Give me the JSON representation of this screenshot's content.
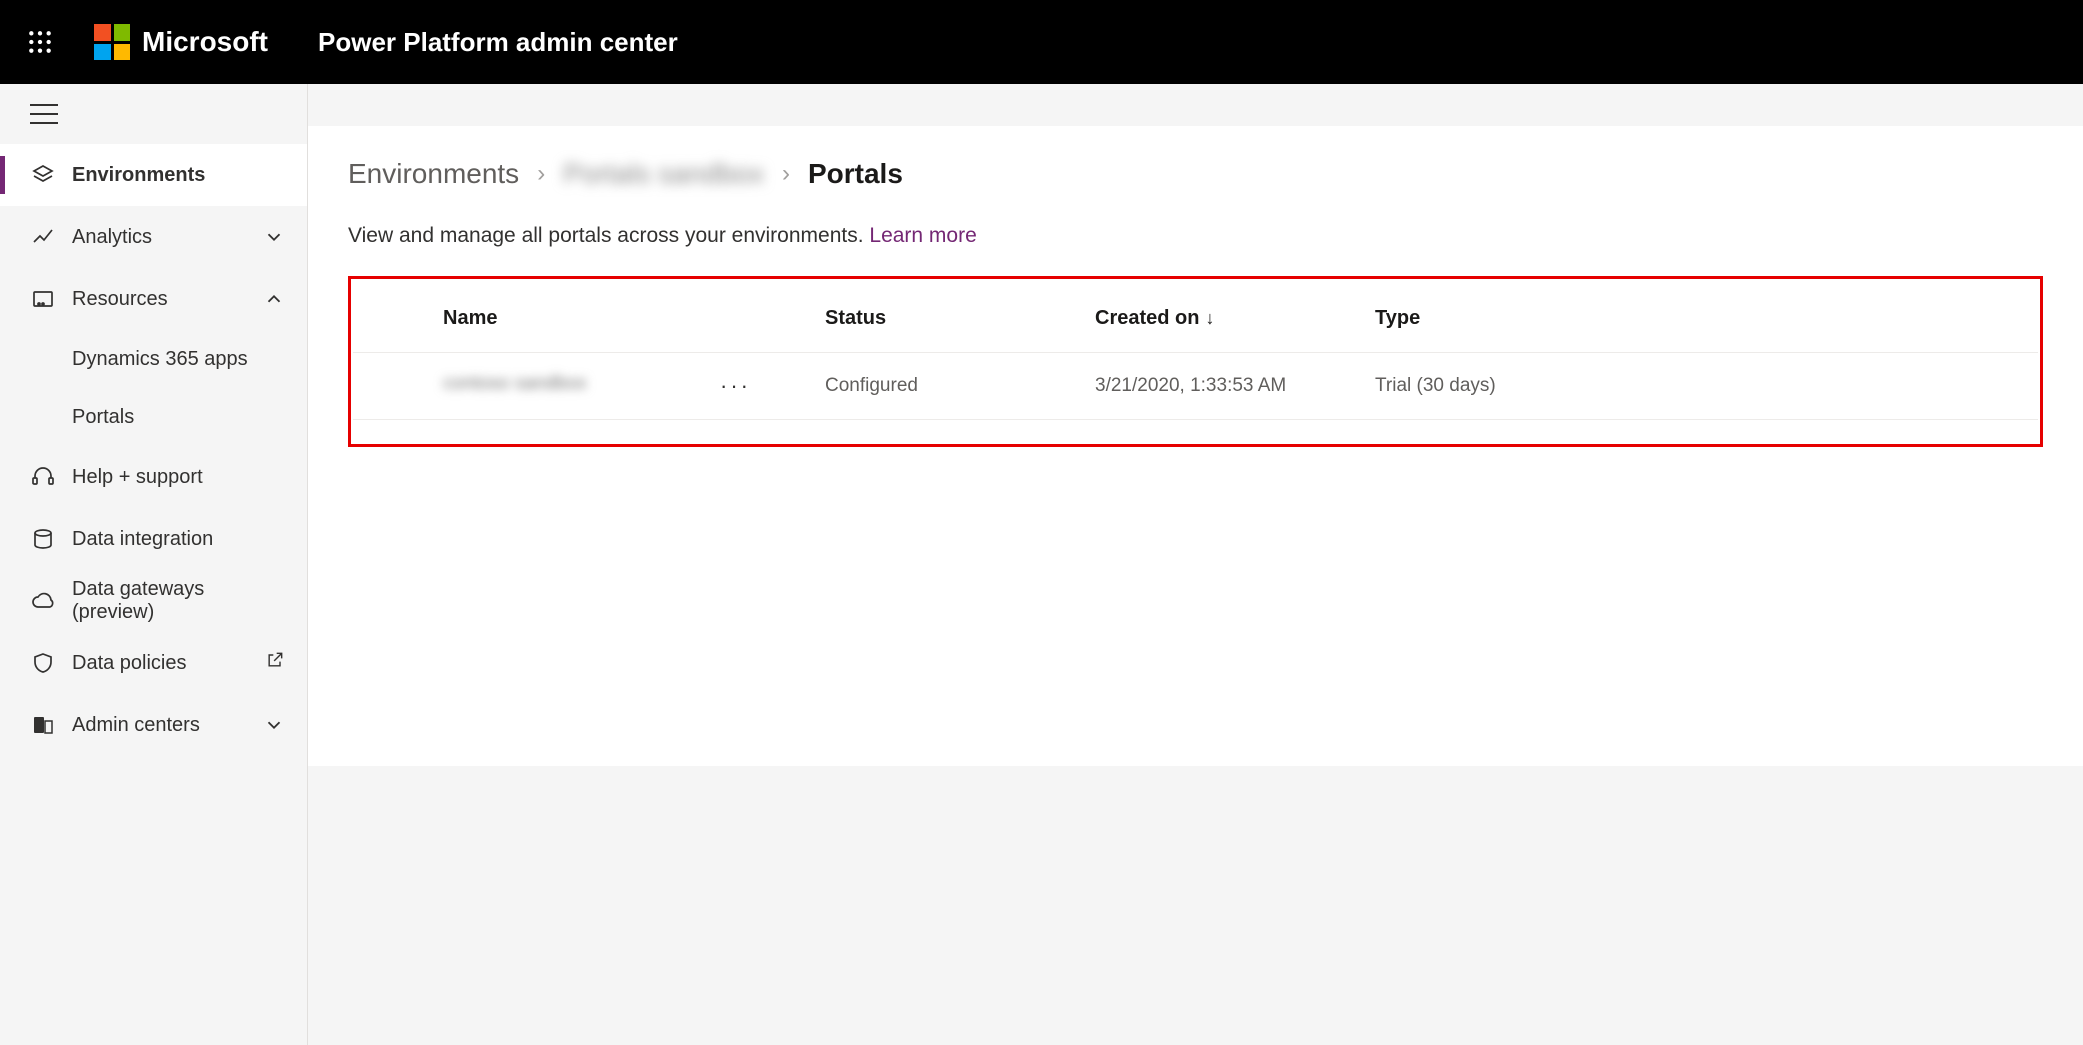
{
  "header": {
    "brand": "Microsoft",
    "app_title": "Power Platform admin center"
  },
  "sidebar": {
    "items": {
      "environments": "Environments",
      "analytics": "Analytics",
      "resources": "Resources",
      "dynamics_apps": "Dynamics 365 apps",
      "portals": "Portals",
      "help_support": "Help + support",
      "data_integration": "Data integration",
      "data_gateways": "Data gateways (preview)",
      "data_policies": "Data policies",
      "admin_centers": "Admin centers"
    }
  },
  "breadcrumb": {
    "root": "Environments",
    "env_name": "Portals sandbox",
    "current": "Portals"
  },
  "description": {
    "text": "View and manage all portals across your environments. ",
    "link": "Learn more"
  },
  "table": {
    "columns": {
      "name": "Name",
      "status": "Status",
      "created_on": "Created on",
      "type": "Type"
    },
    "sort_indicator": "↓",
    "rows": [
      {
        "name": "contoso sandbox",
        "status": "Configured",
        "created_on": "3/21/2020, 1:33:53 AM",
        "type": "Trial (30 days)"
      }
    ]
  }
}
